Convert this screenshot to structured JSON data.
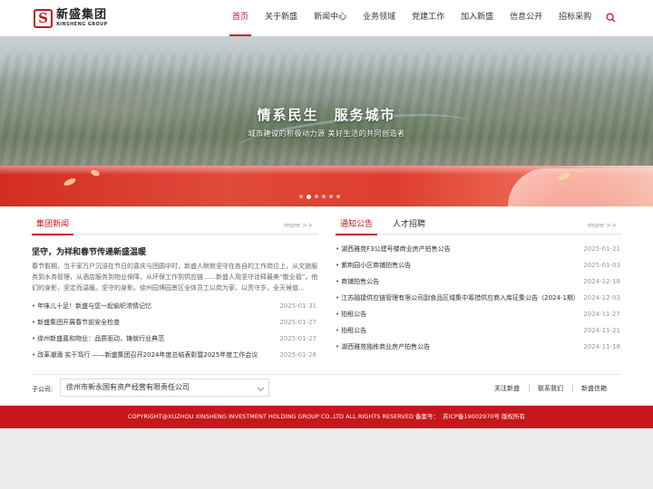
{
  "brand": {
    "logo_letter": "S",
    "name_cn": "新盛集团",
    "name_en": "XINSHENG GROUP",
    "accent": "#c8161d"
  },
  "nav": {
    "items": [
      {
        "label": "首页",
        "active": true
      },
      {
        "label": "关于新盛"
      },
      {
        "label": "新闻中心"
      },
      {
        "label": "业务领域"
      },
      {
        "label": "党建工作"
      },
      {
        "label": "加入新盛"
      },
      {
        "label": "信息公开"
      },
      {
        "label": "招标采购"
      }
    ],
    "search_icon": "search-icon"
  },
  "banner": {
    "title": "情系民生　服务城市",
    "subtitle": "城市建设的积极动力源 美好生活的共同创造者",
    "slide_count": 6,
    "active_slide": 1
  },
  "group_news": {
    "tab": "集团新闻",
    "more": "more >>",
    "featured": {
      "title": "坚守，为祥和春节传递新盛温暖",
      "summary": "春节假期，当千家万户沉浸在节日的喜庆与团圆中时，新盛人默默坚守在各自的工作岗位上，从文旅服务到水务管理，从酒店服务到物业保障，从环保工作到供应链……新盛人用坚守诠释最美“敬业福”，他们的身影，坚定而温暖。坚守的身影。徐州园博园景区全体员工以岗为家、以责守岁，全天候值…"
    },
    "items": [
      {
        "title": "年味儿十足！新盛与您一起偷织浓情记忆",
        "date": "2025-01-31"
      },
      {
        "title": "新盛集团开展春节前安全检查",
        "date": "2025-01-27"
      },
      {
        "title": "徐州新盛嘉和物业：品质驱动，铸就行业典范",
        "date": "2025-01-27"
      },
      {
        "title": "改革潮涌 实干笃行 ——新盛集团召开2024年度总结表彰暨2025年度工作会议",
        "date": "2025-01-26"
      }
    ]
  },
  "notices": {
    "tabs": [
      "通知公告",
      "人才招聘"
    ],
    "more": "more >>",
    "items": [
      {
        "title": "湖西雅苑F3公建号楼商业房产拍售公告",
        "date": "2025-01-21"
      },
      {
        "title": "紫荆园小区商铺拍售公告",
        "date": "2025-01-03"
      },
      {
        "title": "商铺拍售公告",
        "date": "2024-12-18"
      },
      {
        "title": "江苏融捷供应链管理有限公司副食品区域集中筹措供应商入库征集公告（2024-1期）",
        "date": "2024-12-03"
      },
      {
        "title": "拍租公告",
        "date": "2024-11-27"
      },
      {
        "title": "拍租公告",
        "date": "2024-11-21"
      },
      {
        "title": "湖西雅苑独栋商业房产拍售公告",
        "date": "2024-11-18"
      }
    ]
  },
  "subsidiary": {
    "label": "子公司:",
    "selected": "徐州市新永国有资产经营有限责任公司"
  },
  "links": [
    "关注新盛",
    "联系我们",
    "新盛信箱"
  ],
  "footer": {
    "copyright": "COPYRIGHT@XUZHOU XINSHENG INVESTMENT HOLDING GROUP CO.,LTD ALL RIGHTS RESERVED 备案号：",
    "icp": "苏ICP备19002970号 版权所有"
  }
}
